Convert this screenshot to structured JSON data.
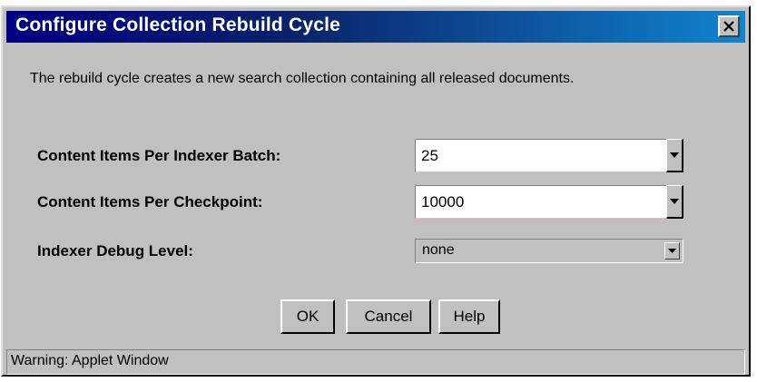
{
  "window": {
    "title": "Configure Collection Rebuild Cycle",
    "close_label": "×"
  },
  "description": "The rebuild cycle creates a new search collection containing all released documents.",
  "form": {
    "indexer_batch": {
      "label": "Content Items Per Indexer Batch:",
      "value": "25"
    },
    "checkpoint": {
      "label": "Content Items Per Checkpoint:",
      "value": "10000"
    },
    "debug_level": {
      "label": "Indexer Debug Level:",
      "value": "none"
    }
  },
  "buttons": {
    "ok": "OK",
    "cancel": "Cancel",
    "help": "Help"
  },
  "status": "Warning: Applet Window",
  "colors": {
    "title_bar_start": "#000080",
    "title_bar_end": "#1084d0",
    "dialog_bg": "#c0c0c0"
  }
}
